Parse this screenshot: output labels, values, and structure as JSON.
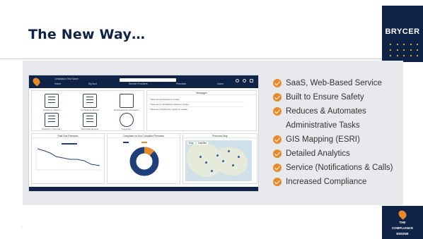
{
  "slide": {
    "title": "The New Way…",
    "brand": "BRYCER",
    "brand_accent": "#d9a73a",
    "navy": "#0f2346",
    "orange": "#e98a2a",
    "logo_text": [
      "THE",
      "COMPLIANCE",
      "ENGINE"
    ],
    "bullets": [
      "SaaS, Web-Based Service",
      "Built to Ensure Safety",
      "Reduces & Automates",
      "GIS Mapping (ESRI)",
      "Detailed Analytics",
      "Service (Notifications & Calls)",
      "Increased Compliance"
    ],
    "bullet_continuation": "Administrative Tasks",
    "bullet_icon": "check-circle-icon"
  },
  "app": {
    "topbar": {
      "org": "Jurisdiction Test Name",
      "nav": [
        "Home",
        "My Acct",
        "Service Providers",
        "Premises",
        "Users"
      ]
    },
    "panels": {
      "messages_title": "Messages",
      "messages": [
        "There are 0 premises to review",
        "There are 0 compliance reports to review",
        "There are 0 deficiency reports to review"
      ],
      "tiles": [
        "Deficiency Report",
        "Compliance Report",
        "Requested Documentation",
        "Deficiency Summary",
        "Submitted Reports",
        "Inspection"
      ],
      "chart1_title": "Past Due Premises",
      "chart2_title": "Compliant vs Non Compliant Premises",
      "chart3_title": "Premises Map",
      "map_tabs": [
        "Map",
        "Satellite"
      ],
      "donut_compliant_fraction": 0.12
    }
  }
}
